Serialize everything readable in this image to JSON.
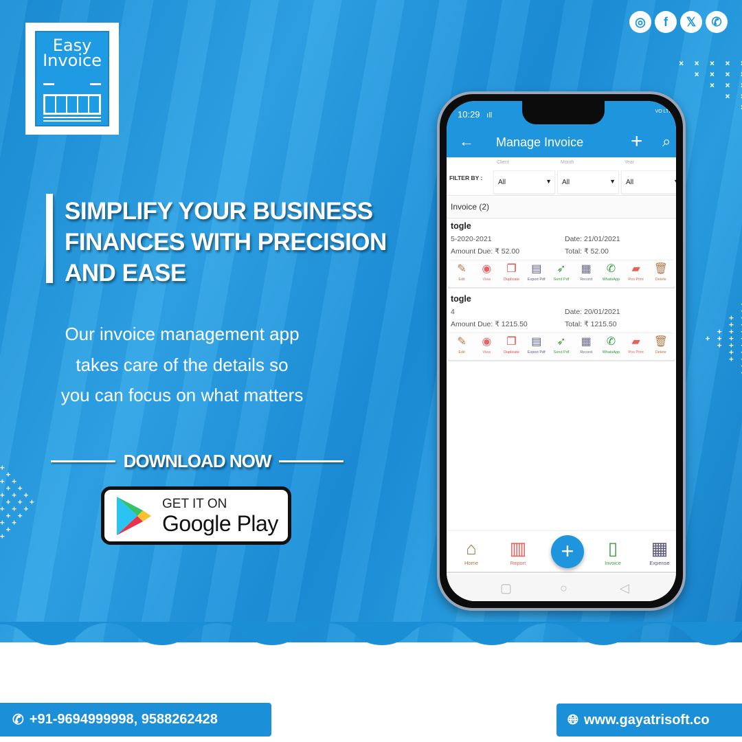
{
  "brand": {
    "logo_line1": "Easy",
    "logo_line2": "Invoice"
  },
  "social": [
    {
      "icon": "instagram-icon",
      "glyph": "◎"
    },
    {
      "icon": "facebook-icon",
      "glyph": "f"
    },
    {
      "icon": "x-twitter-icon",
      "glyph": "𝕏"
    },
    {
      "icon": "whatsapp-icon",
      "glyph": "✆"
    }
  ],
  "headline": {
    "line1": "SIMPLIFY YOUR BUSINESS",
    "line2": "FINANCES WITH PRECISION",
    "line3": "AND EASE"
  },
  "subtext": {
    "line1": "Our invoice management app",
    "line2": "takes care of the details so",
    "line3": "you can focus on what matters"
  },
  "download": {
    "label": "DOWNLOAD NOW",
    "store_small": "GET IT ON",
    "store_big": "Google Play"
  },
  "phone": {
    "status": {
      "time": "10:29",
      "signal": "ıll",
      "right": "VO LTE"
    },
    "appbar": {
      "back": "←",
      "title": "Manage Invoice",
      "add": "+",
      "search": "⌕"
    },
    "filter": {
      "label": "FILTER BY :",
      "selects": [
        {
          "caption": "Client",
          "value": "All"
        },
        {
          "caption": "Month",
          "value": "All"
        },
        {
          "caption": "Year",
          "value": "All"
        }
      ]
    },
    "invoice_count": "Invoice (2)",
    "invoices": [
      {
        "client": "togle",
        "number": "5-2020-2021",
        "date": "Date: 21/01/2021",
        "amount_due": "Amount Due: ₹ 52.00",
        "total": "Total: ₹ 52.00"
      },
      {
        "client": "togle",
        "number": "4",
        "date": "Date: 20/01/2021",
        "amount_due": "Amount Due: ₹ 1215.50",
        "total": "Total: ₹ 1215.50"
      }
    ],
    "actions": [
      {
        "label": "Edit",
        "glyph": "✎",
        "color": "#b07a4a"
      },
      {
        "label": "View",
        "glyph": "◉",
        "color": "#e26565"
      },
      {
        "label": "Duplicate",
        "glyph": "❐",
        "color": "#e8453c"
      },
      {
        "label": "Export Pdf",
        "glyph": "▤",
        "color": "#5a5f8a"
      },
      {
        "label": "Send Pdf",
        "glyph": "➶",
        "color": "#3f9a45"
      },
      {
        "label": "Record",
        "glyph": "▦",
        "color": "#6b6b8a"
      },
      {
        "label": "WhatsApp",
        "glyph": "✆",
        "color": "#2c9a3c"
      },
      {
        "label": "Pos Print",
        "glyph": "▰",
        "color": "#e8605a"
      },
      {
        "label": "Delete",
        "glyph": "🗑",
        "color": "#b07a4a"
      }
    ],
    "bottom_nav": [
      {
        "label": "Home",
        "glyph": "⌂",
        "color": "#a8743f"
      },
      {
        "label": "Report",
        "glyph": "▥",
        "color": "#ef5a55"
      },
      {
        "label": "Invoice",
        "glyph": "▯",
        "color": "#3f9a45"
      },
      {
        "label": "Expense",
        "glyph": "▦",
        "color": "#555577"
      }
    ],
    "fab": "+",
    "sysnav": {
      "recent": "▢",
      "home": "○",
      "back": "◁"
    }
  },
  "footer": {
    "phone": "+91-9694999998, 9588262428",
    "website": "www.gayatrisoft.co"
  },
  "colors": {
    "primary": "#1e95dd",
    "dark_blue": "#1b90d8"
  }
}
